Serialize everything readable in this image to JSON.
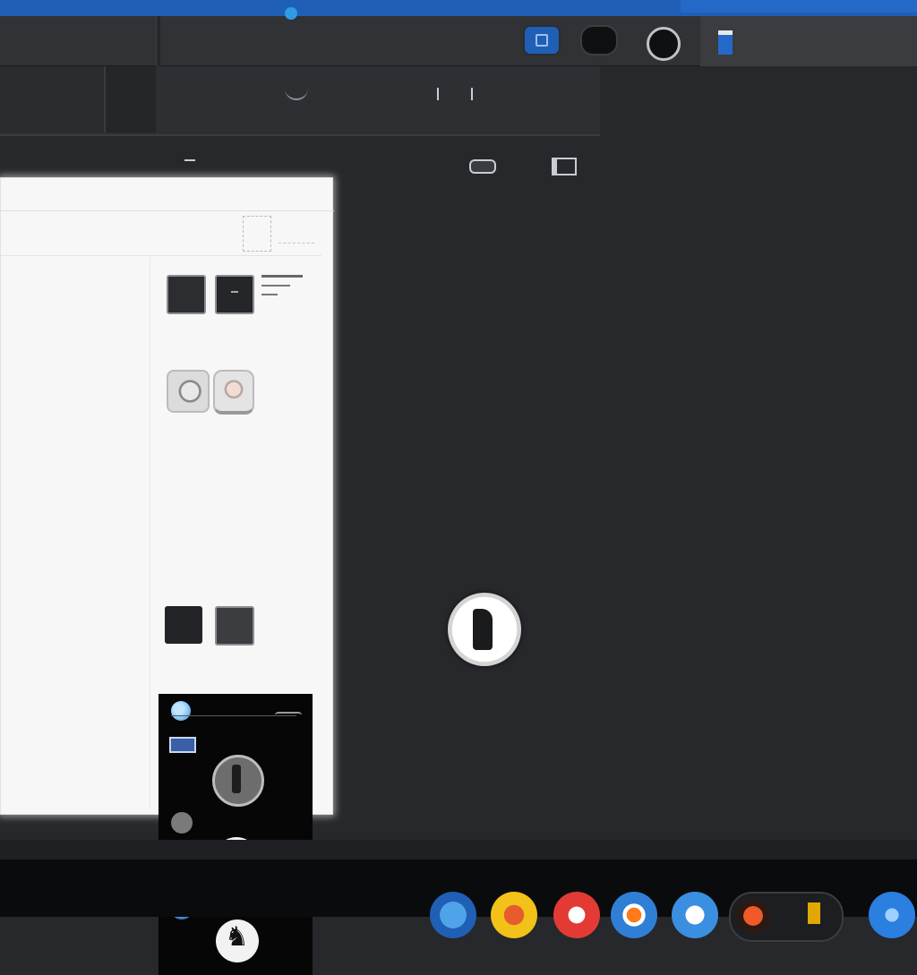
{
  "titlebar": {
    "app_title": "",
    "document_title": "",
    "user_name": ""
  },
  "toolbar2": {
    "left_label": "",
    "item1": "",
    "item2": "",
    "item3": ""
  },
  "row3": {
    "label": ""
  },
  "document": {
    "header_text": "",
    "sidebar": {
      "thumb_a_glyph": "",
      "heading": "",
      "subheading": "",
      "thumb_g_text": "",
      "section_label": ""
    },
    "dark_card": {
      "item1": "",
      "item2": "",
      "item3": "",
      "item4": "",
      "item5": ""
    }
  },
  "icons": {
    "dock": [
      "app-icon-1",
      "app-icon-2",
      "app-icon-3",
      "app-icon-4",
      "app-icon-5",
      "app-icon-6",
      "app-icon-7"
    ]
  },
  "colors": {
    "accent": "#1f5fb6",
    "background": "#26282b",
    "panel": "#f7f7f7",
    "taskbar": "#0a0b0d"
  }
}
